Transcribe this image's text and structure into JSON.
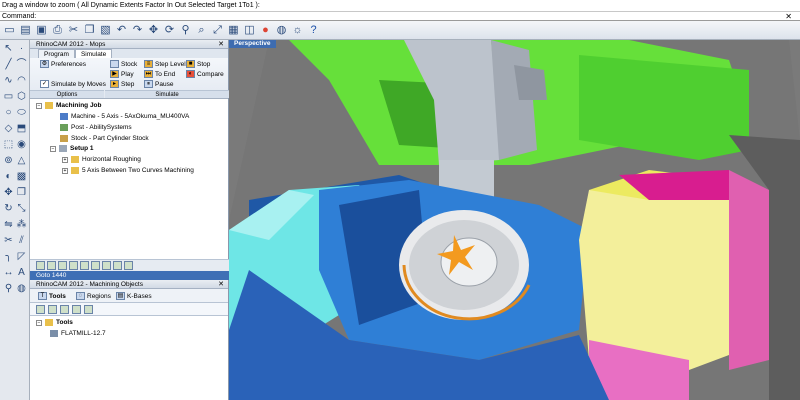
{
  "history_line": "Drag a window to zoom ( All  Dynamic  Extents  Factor  In  Out  Selected  Target  1To1 ):",
  "command": {
    "label": "Command:"
  },
  "ops_panel": {
    "title": "RhinoCAM 2012 - Mops",
    "tabs": [
      "Program",
      "Simulate"
    ],
    "ribbon": {
      "preferences": "Preferences",
      "simulate_by_moves": "Simulate by Moves",
      "stock": "Stock",
      "play": "Play",
      "step": "Step",
      "step_levels": "Step Levels",
      "to_end": "To End",
      "pause": "Pause",
      "stop": "Stop",
      "compare": "Compare",
      "group_options": "Options",
      "group_simulate": "Simulate"
    },
    "tree": {
      "root": "Machining Job",
      "machine": "Machine - 5 Axis - 5AxOkuma_MU400VA",
      "post": "Post - AbilitySystems",
      "stock": "Stock - Part Cylinder Stock",
      "setup": "Setup 1",
      "op1": "Horizontal Roughing",
      "op2": "5 Axis Between Two Curves Machining"
    }
  },
  "status": {
    "text": "Goto 1440"
  },
  "objects_panel": {
    "title": "RhinoCAM 2012 - Machining Objects",
    "tabs": [
      "Tools",
      "Regions",
      "K-Bases"
    ],
    "tree": {
      "root": "Tools",
      "tool": "FLATMILL-12.7"
    }
  },
  "viewport": {
    "title": "Perspective"
  },
  "colors": {
    "status_bar": "#3f6fb5",
    "machine_green": "#66e03a",
    "table_blue": "#2f7fd6",
    "cyan_block": "#6ee6e6",
    "magenta_block": "#d81d8f",
    "yellow_block": "#f3ef9b",
    "spindle_gray": "#bcc3cc"
  },
  "icons": {
    "toolbar": [
      "new-icon",
      "open-icon",
      "save-icon",
      "print-icon",
      "cut-icon",
      "copy-icon",
      "paste-icon",
      "undo-icon",
      "redo-icon",
      "pan-icon",
      "rotate-icon",
      "zoom-icon",
      "zoom-window-icon",
      "zoom-extents-icon",
      "grid-icon",
      "layer-icon",
      "color-icon",
      "render-icon",
      "lights-icon",
      "help-icon"
    ]
  }
}
